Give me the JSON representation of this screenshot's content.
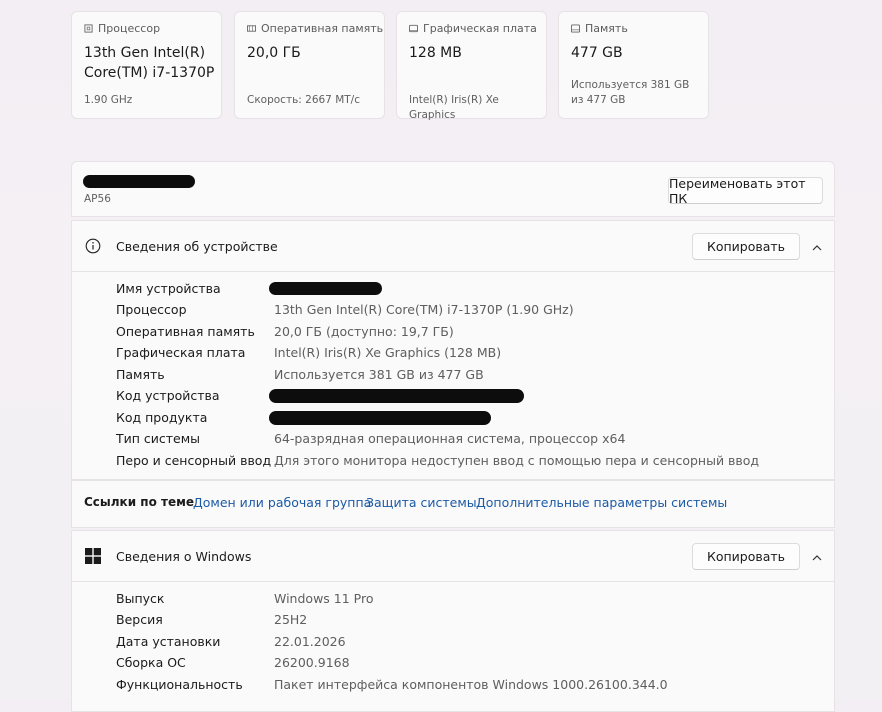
{
  "cards": [
    {
      "icon": "processor-icon",
      "title": "Процессор",
      "value": "13th Gen Intel(R) Core(TM) i7-1370P",
      "sub": "1.90 GHz"
    },
    {
      "icon": "memory-icon",
      "title": "Оперативная память",
      "value": "20,0 ГБ",
      "sub": "Скорость: 2667 МТ/с"
    },
    {
      "icon": "graphics-icon",
      "title": "Графическая плата",
      "value": "128 MB",
      "sub": "Intel(R) Iris(R) Xe Graphics"
    },
    {
      "icon": "storage-icon",
      "title": "Память",
      "value": "477 GB",
      "sub": "Используется 381 GB из 477 GB"
    }
  ],
  "pc": {
    "model": "AP56",
    "rename_label": "Переименовать этот ПК"
  },
  "device": {
    "title": "Сведения об устройстве",
    "copy_label": "Копировать",
    "rows": [
      {
        "k": "Имя устройства",
        "v": ""
      },
      {
        "k": "Процессор",
        "v": "13th Gen Intel(R) Core(TM) i7-1370P (1.90 GHz)"
      },
      {
        "k": "Оперативная память",
        "v": "20,0 ГБ (доступно: 19,7 ГБ)"
      },
      {
        "k": "Графическая плата",
        "v": "Intel(R) Iris(R) Xe Graphics (128 MB)"
      },
      {
        "k": "Память",
        "v": "Используется 381 GB из 477 GB"
      },
      {
        "k": "Код устройства",
        "v": ""
      },
      {
        "k": "Код продукта",
        "v": ""
      },
      {
        "k": "Тип системы",
        "v": "64-разрядная операционная система, процессор x64"
      },
      {
        "k": "Перо и сенсорный ввод",
        "v": "Для этого монитора недоступен ввод с помощью пера и сенсорный ввод"
      }
    ]
  },
  "links": {
    "label": "Ссылки по теме",
    "items": [
      "Домен или рабочая группа",
      "Защита системы",
      "Дополнительные параметры системы"
    ]
  },
  "windows": {
    "title": "Сведения о Windows",
    "copy_label": "Копировать",
    "rows": [
      {
        "k": "Выпуск",
        "v": "Windows 11 Pro"
      },
      {
        "k": "Версия",
        "v": "25H2"
      },
      {
        "k": "Дата установки",
        "v": "22.01.2026"
      },
      {
        "k": "Сборка ОС",
        "v": "26200.9168"
      },
      {
        "k": "Функциональность",
        "v": "Пакет интерфейса компонентов Windows 1000.26100.344.0"
      }
    ]
  }
}
